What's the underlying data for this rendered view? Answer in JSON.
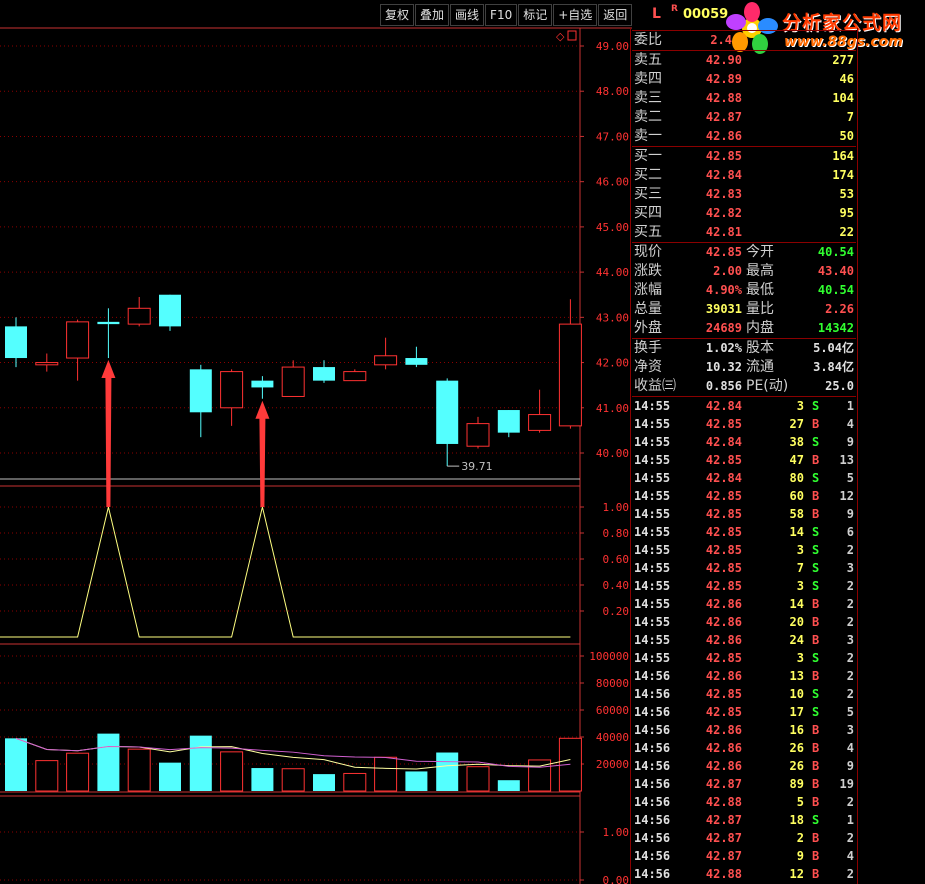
{
  "toolbar": {
    "buttons": [
      "复权",
      "叠加",
      "画线",
      "F10",
      "标记",
      "+自选",
      "返回"
    ]
  },
  "stock": {
    "market_flag": "L",
    "r_flag": "R",
    "code": "00059"
  },
  "logo": {
    "text": "分析家公式网",
    "url": "www.88gs.com"
  },
  "quote": {
    "weibi_label": "委比",
    "weibi_value": "2.4",
    "asks": [
      {
        "label": "卖五",
        "price": "42.90",
        "vol": "277"
      },
      {
        "label": "卖四",
        "price": "42.89",
        "vol": "46"
      },
      {
        "label": "卖三",
        "price": "42.88",
        "vol": "104"
      },
      {
        "label": "卖二",
        "price": "42.87",
        "vol": "7"
      },
      {
        "label": "卖一",
        "price": "42.86",
        "vol": "50"
      }
    ],
    "bids": [
      {
        "label": "买一",
        "price": "42.85",
        "vol": "164"
      },
      {
        "label": "买二",
        "price": "42.84",
        "vol": "174"
      },
      {
        "label": "买三",
        "price": "42.83",
        "vol": "53"
      },
      {
        "label": "买四",
        "price": "42.82",
        "vol": "95"
      },
      {
        "label": "买五",
        "price": "42.81",
        "vol": "22"
      }
    ],
    "stats": [
      {
        "l1": "现价",
        "v1": "42.85",
        "c1": "#ff5050",
        "l2": "今开",
        "v2": "40.54",
        "c2": "#30ff30"
      },
      {
        "l1": "涨跌",
        "v1": "2.00",
        "c1": "#ff5050",
        "l2": "最高",
        "v2": "43.40",
        "c2": "#ff5050"
      },
      {
        "l1": "涨幅",
        "v1": "4.90%",
        "c1": "#ff5050",
        "l2": "最低",
        "v2": "40.54",
        "c2": "#30ff30"
      },
      {
        "l1": "总量",
        "v1": "39031",
        "c1": "#ffff60",
        "l2": "量比",
        "v2": "2.26",
        "c2": "#ff5050"
      },
      {
        "l1": "外盘",
        "v1": "24689",
        "c1": "#ff5050",
        "l2": "内盘",
        "v2": "14342",
        "c2": "#30ff30"
      }
    ],
    "finance": [
      {
        "l1": "换手",
        "v1": "1.02%",
        "l2": "股本",
        "v2": "5.04亿"
      },
      {
        "l1": "净资",
        "v1": "10.32",
        "l2": "流通",
        "v2": "3.84亿"
      },
      {
        "l1": "收益㈢",
        "v1": "0.856",
        "l2": "PE(动)",
        "v2": "25.0"
      }
    ]
  },
  "ticks": [
    [
      "14:55",
      "42.84",
      "3",
      "S",
      "1"
    ],
    [
      "14:55",
      "42.85",
      "27",
      "B",
      "4"
    ],
    [
      "14:55",
      "42.84",
      "38",
      "S",
      "9"
    ],
    [
      "14:55",
      "42.85",
      "47",
      "B",
      "13"
    ],
    [
      "14:55",
      "42.84",
      "80",
      "S",
      "5"
    ],
    [
      "14:55",
      "42.85",
      "60",
      "B",
      "12"
    ],
    [
      "14:55",
      "42.85",
      "58",
      "B",
      "9"
    ],
    [
      "14:55",
      "42.85",
      "14",
      "S",
      "6"
    ],
    [
      "14:55",
      "42.85",
      "3",
      "S",
      "2"
    ],
    [
      "14:55",
      "42.85",
      "7",
      "S",
      "3"
    ],
    [
      "14:55",
      "42.85",
      "3",
      "S",
      "2"
    ],
    [
      "14:55",
      "42.86",
      "14",
      "B",
      "2"
    ],
    [
      "14:55",
      "42.86",
      "20",
      "B",
      "2"
    ],
    [
      "14:55",
      "42.86",
      "24",
      "B",
      "3"
    ],
    [
      "14:55",
      "42.85",
      "3",
      "S",
      "2"
    ],
    [
      "14:56",
      "42.86",
      "13",
      "B",
      "2"
    ],
    [
      "14:56",
      "42.85",
      "10",
      "S",
      "2"
    ],
    [
      "14:56",
      "42.85",
      "17",
      "S",
      "5"
    ],
    [
      "14:56",
      "42.86",
      "16",
      "B",
      "3"
    ],
    [
      "14:56",
      "42.86",
      "26",
      "B",
      "4"
    ],
    [
      "14:56",
      "42.86",
      "26",
      "B",
      "9"
    ],
    [
      "14:56",
      "42.87",
      "89",
      "B",
      "19"
    ],
    [
      "14:56",
      "42.88",
      "5",
      "B",
      "2"
    ],
    [
      "14:56",
      "42.87",
      "18",
      "S",
      "1"
    ],
    [
      "14:56",
      "42.87",
      "2",
      "B",
      "2"
    ],
    [
      "14:56",
      "42.87",
      "9",
      "B",
      "4"
    ],
    [
      "14:56",
      "42.88",
      "12",
      "B",
      "2"
    ]
  ],
  "chart_data": {
    "type": "candlestick",
    "price_axis": {
      "ticks": [
        "49.00",
        "48.00",
        "47.00",
        "46.00",
        "45.00",
        "44.00",
        "43.00",
        "42.00",
        "41.00",
        "40.00"
      ],
      "ylim": [
        39.5,
        49.2
      ]
    },
    "low_annotation": "39.71",
    "candles": [
      {
        "o": 42.1,
        "c": 42.8,
        "h": 43.0,
        "l": 41.9,
        "up": false
      },
      {
        "o": 41.95,
        "c": 42.0,
        "h": 42.2,
        "l": 41.8,
        "up": true
      },
      {
        "o": 42.1,
        "c": 42.9,
        "h": 42.95,
        "l": 41.6,
        "up": true
      },
      {
        "o": 42.9,
        "c": 42.85,
        "h": 43.2,
        "l": 42.1,
        "up": false
      },
      {
        "o": 42.85,
        "c": 43.2,
        "h": 43.45,
        "l": 42.8,
        "up": true
      },
      {
        "o": 43.5,
        "c": 42.8,
        "h": 43.5,
        "l": 42.7,
        "up": false
      },
      {
        "o": 41.85,
        "c": 40.9,
        "h": 41.95,
        "l": 40.35,
        "up": false
      },
      {
        "o": 41.0,
        "c": 41.8,
        "h": 41.85,
        "l": 40.6,
        "up": true
      },
      {
        "o": 41.6,
        "c": 41.45,
        "h": 41.7,
        "l": 41.2,
        "up": false
      },
      {
        "o": 41.25,
        "c": 41.9,
        "h": 42.05,
        "l": 41.25,
        "up": true
      },
      {
        "o": 41.9,
        "c": 41.6,
        "h": 42.05,
        "l": 41.55,
        "up": false
      },
      {
        "o": 41.6,
        "c": 41.8,
        "h": 41.85,
        "l": 41.6,
        "up": true
      },
      {
        "o": 41.95,
        "c": 42.15,
        "h": 42.55,
        "l": 41.85,
        "up": true
      },
      {
        "o": 42.1,
        "c": 41.95,
        "h": 42.35,
        "l": 41.9,
        "up": false
      },
      {
        "o": 41.6,
        "c": 40.2,
        "h": 41.65,
        "l": 39.71,
        "up": false
      },
      {
        "o": 40.15,
        "c": 40.65,
        "h": 40.8,
        "l": 40.1,
        "up": true
      },
      {
        "o": 40.95,
        "c": 40.45,
        "h": 40.95,
        "l": 40.35,
        "up": false
      },
      {
        "o": 40.5,
        "c": 40.85,
        "h": 41.4,
        "l": 40.45,
        "up": true
      },
      {
        "o": 40.6,
        "c": 42.85,
        "h": 43.4,
        "l": 40.54,
        "up": true
      }
    ],
    "signal_axis": {
      "ticks": [
        "1.00",
        "0.80",
        "0.60",
        "0.40",
        "0.20"
      ],
      "ylim": [
        0,
        1.0
      ]
    },
    "signal_values": [
      0,
      0,
      0,
      1,
      0,
      0,
      0,
      0,
      1,
      0,
      0,
      0,
      0,
      0,
      0,
      0,
      0,
      0,
      0
    ],
    "volume_axis": {
      "ticks": [
        "100000",
        "80000",
        "60000",
        "40000",
        "20000"
      ],
      "ylim": [
        0,
        105000
      ]
    },
    "volumes": [
      39000,
      22500,
      28000,
      42500,
      31000,
      21000,
      41000,
      29000,
      17000,
      16500,
      12500,
      13000,
      25000,
      14500,
      28500,
      18000,
      8000,
      23000,
      39031
    ],
    "bottom_axis": {
      "ticks": [
        "1.00",
        "0.00"
      ]
    }
  }
}
